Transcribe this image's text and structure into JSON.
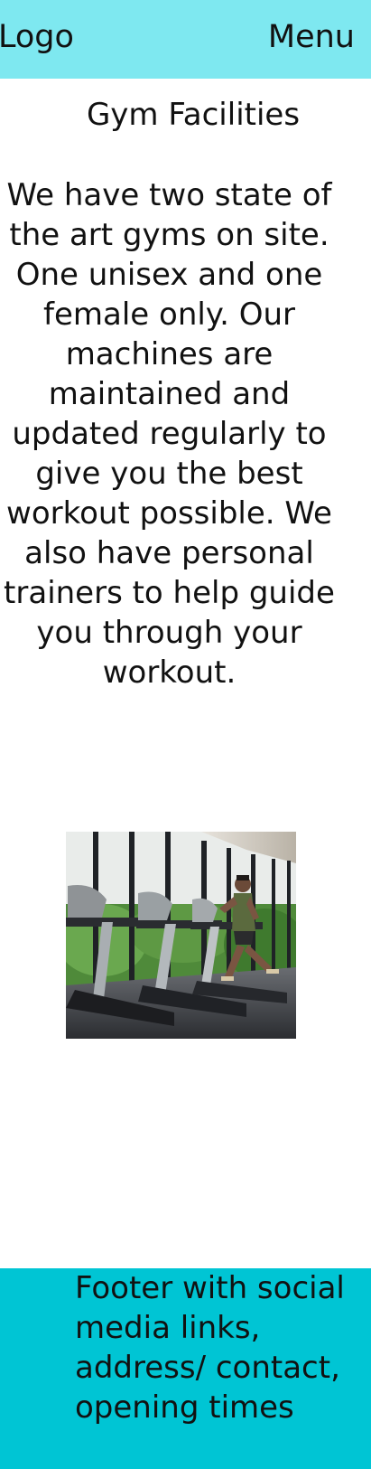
{
  "header": {
    "logo": "Logo",
    "menu": "Menu"
  },
  "main": {
    "title": "Gym Facilities",
    "intro": "We have two state of the art gyms on site. One unisex and one female only. Our machines are maintained and updated regularly to give you the best workout possible. We also have personal trainers to help guide you through your workout."
  },
  "footer": {
    "text": "Footer with social media links, address/ contact, opening times"
  },
  "colors": {
    "header_bg": "#7ee8f0",
    "footer_bg": "#00c5d4"
  }
}
